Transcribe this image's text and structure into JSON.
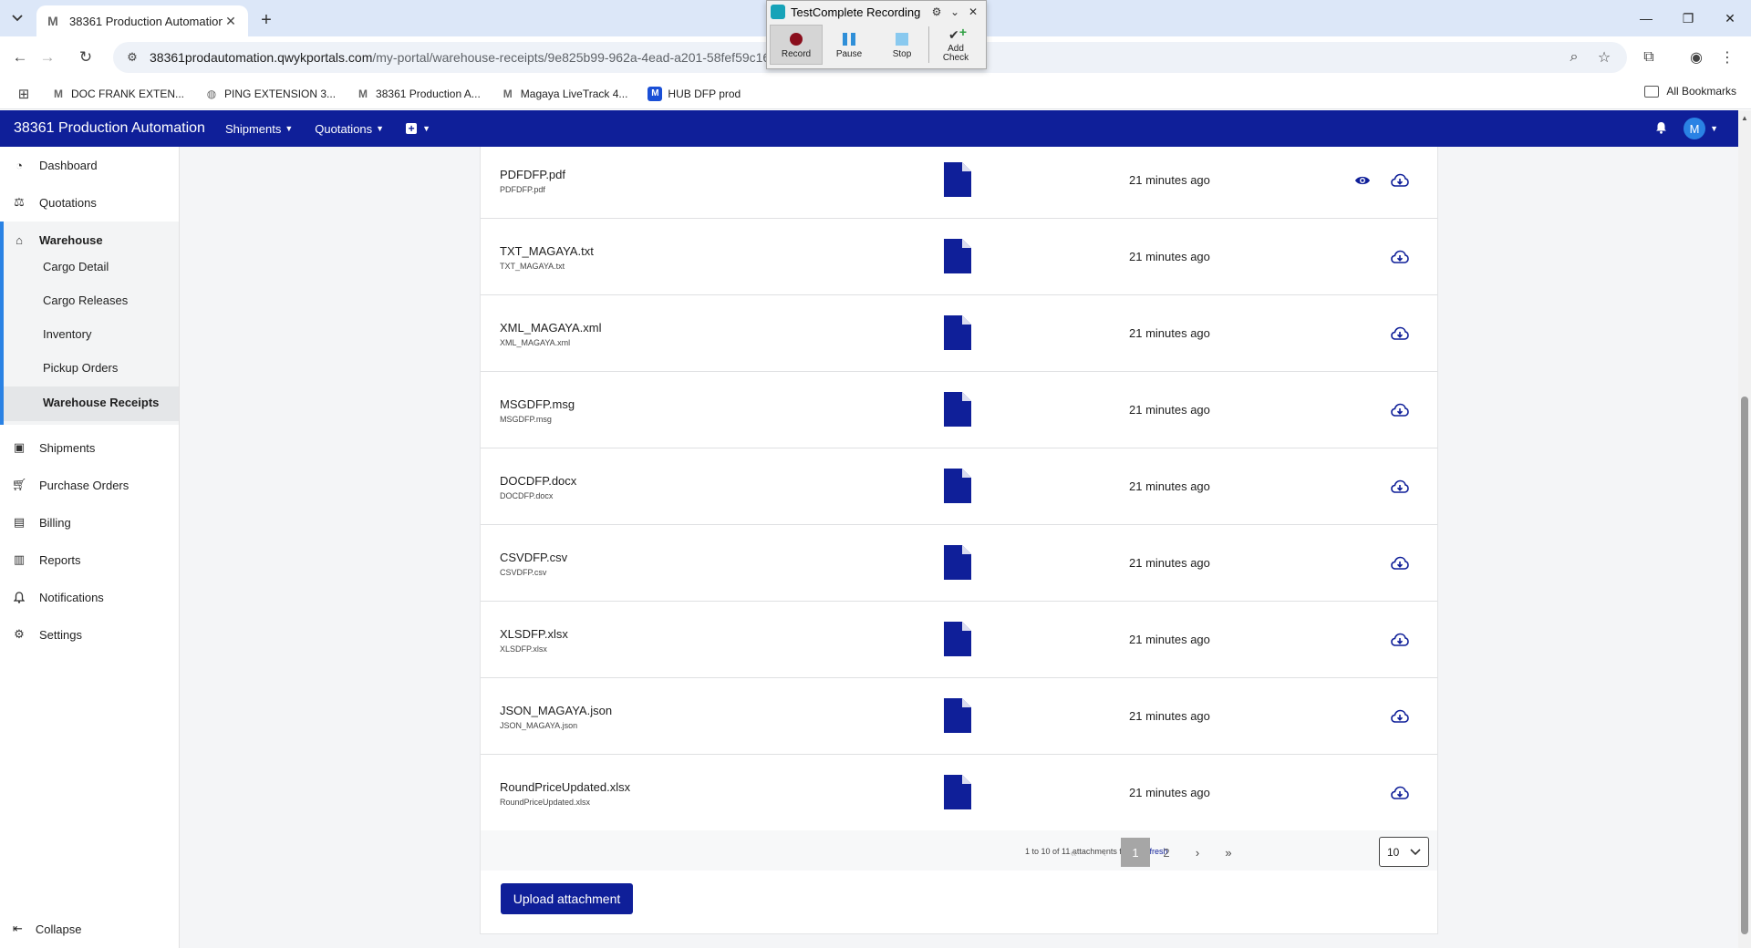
{
  "browser": {
    "tab_title": "38361 Production Automation",
    "tab_favicon": "M",
    "url_host": "38361prodautomation.qwykportals.com",
    "url_path": "/my-portal/warehouse-receipts/9e825b99-962a-4ead-a201-58fef59c16",
    "bookmarks": [
      {
        "label": "DOC FRANK EXTEN...",
        "icon": "M"
      },
      {
        "label": "PING EXTENSION 3...",
        "icon": "globe"
      },
      {
        "label": "38361 Production A...",
        "icon": "M"
      },
      {
        "label": "Magaya LiveTrack 4...",
        "icon": "M"
      },
      {
        "label": "HUB DFP prod",
        "icon": "M-blue"
      }
    ],
    "all_bookmarks": "All Bookmarks"
  },
  "testcomplete": {
    "title": "TestComplete Recording",
    "record": "Record",
    "pause": "Pause",
    "stop": "Stop",
    "add_check_1": "Add",
    "add_check_2": "Check"
  },
  "header": {
    "brand": "38361 Production Automation",
    "nav": [
      "Shipments",
      "Quotations"
    ],
    "avatar_initial": "M"
  },
  "sidebar": {
    "items": {
      "dashboard": "Dashboard",
      "quotations": "Quotations",
      "warehouse": "Warehouse",
      "shipments": "Shipments",
      "purchase_orders": "Purchase Orders",
      "billing": "Billing",
      "reports": "Reports",
      "notifications": "Notifications",
      "settings": "Settings"
    },
    "warehouse_sub": [
      "Cargo Detail",
      "Cargo Releases",
      "Inventory",
      "Pickup Orders",
      "Warehouse Receipts"
    ],
    "active_sub": "Warehouse Receipts",
    "collapse": "Collapse"
  },
  "attachments": [
    {
      "name": "PDFDFP.pdf",
      "file": "PDFDFP.pdf",
      "time": "21 minutes ago",
      "preview": true
    },
    {
      "name": "TXT_MAGAYA.txt",
      "file": "TXT_MAGAYA.txt",
      "time": "21 minutes ago",
      "preview": false
    },
    {
      "name": "XML_MAGAYA.xml",
      "file": "XML_MAGAYA.xml",
      "time": "21 minutes ago",
      "preview": false
    },
    {
      "name": "MSGDFP.msg",
      "file": "MSGDFP.msg",
      "time": "21 minutes ago",
      "preview": false
    },
    {
      "name": "DOCDFP.docx",
      "file": "DOCDFP.docx",
      "time": "21 minutes ago",
      "preview": false
    },
    {
      "name": "CSVDFP.csv",
      "file": "CSVDFP.csv",
      "time": "21 minutes ago",
      "preview": false
    },
    {
      "name": "XLSDFP.xlsx",
      "file": "XLSDFP.xlsx",
      "time": "21 minutes ago",
      "preview": false
    },
    {
      "name": "JSON_MAGAYA.json",
      "file": "JSON_MAGAYA.json",
      "time": "21 minutes ago",
      "preview": false
    },
    {
      "name": "RoundPriceUpdated.xlsx",
      "file": "RoundPriceUpdated.xlsx",
      "time": "21 minutes ago",
      "preview": false
    }
  ],
  "pager": {
    "summary": "1 to 10 of 11 attachments found",
    "refresh": "refresh",
    "pages": [
      "1",
      "2"
    ],
    "current_page": "1",
    "page_size": "10"
  },
  "upload_button": "Upload attachment",
  "colors": {
    "brand_navy": "#0f1f99",
    "accent_blue": "#2a82e4"
  }
}
